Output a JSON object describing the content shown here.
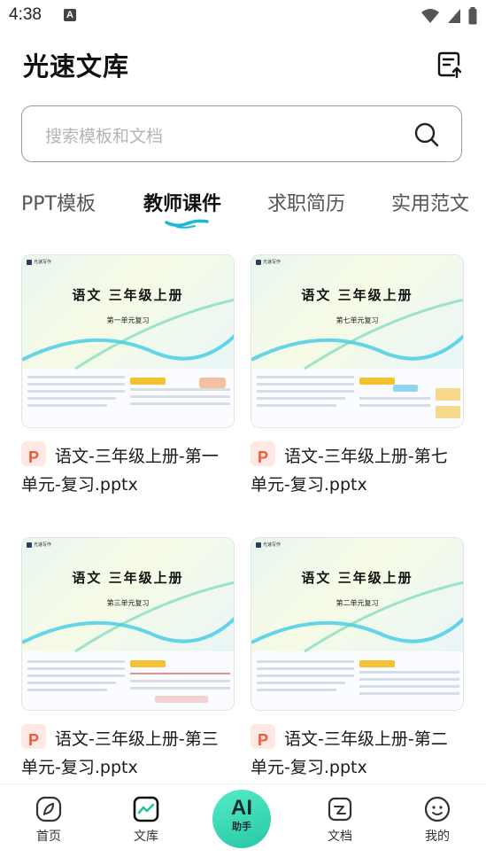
{
  "status_bar": {
    "time": "4:38",
    "notification_glyph": "A"
  },
  "header": {
    "title": "光速文库"
  },
  "search": {
    "placeholder": "搜索模板和文档"
  },
  "tabs": [
    {
      "label": "PPT模板",
      "active": false
    },
    {
      "label": "教师课件",
      "active": true
    },
    {
      "label": "求职简历",
      "active": false
    },
    {
      "label": "实用范文",
      "active": false
    }
  ],
  "file_badge": "P",
  "cards": [
    {
      "thumb_brand": "光速写作",
      "thumb_title": "语文   三年级上册",
      "thumb_subtitle": "第一单元复习",
      "name": "语文-三年级上册-第一单元-复习.pptx"
    },
    {
      "thumb_brand": "光速写作",
      "thumb_title": "语文   三年级上册",
      "thumb_subtitle": "第七单元复习",
      "name": "语文-三年级上册-第七单元-复习.pptx"
    },
    {
      "thumb_brand": "光速写作",
      "thumb_title": "语文   三年级上册",
      "thumb_subtitle": "第三单元复习",
      "name": "语文-三年级上册-第三单元-复习.pptx"
    },
    {
      "thumb_brand": "光速写作",
      "thumb_title": "语文   三年级上册",
      "thumb_subtitle": "第二单元复习",
      "name": "语文-三年级上册-第二单元-复习.pptx"
    }
  ],
  "bottom_nav": {
    "home": "首页",
    "library": "文库",
    "ai_big": "AI",
    "ai_small": "助手",
    "docs": "文档",
    "mine": "我的"
  },
  "colors": {
    "accent": "#2ccba9",
    "ppt_badge": "#f05a36",
    "tab_underline": "#1cb7d9"
  }
}
